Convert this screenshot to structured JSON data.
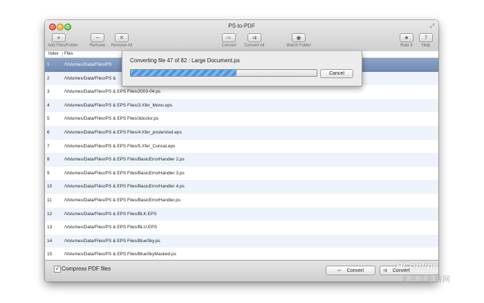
{
  "window": {
    "title": "PS-to-PDF"
  },
  "toolbar": {
    "add_files": "Add Files/Folder",
    "remove": "Remove",
    "remove_all": "Remove All",
    "convert": "Convert",
    "convert_all": "Convert All",
    "watch_folder": "Watch Folder",
    "rate_it": "Rate It",
    "help": "Help"
  },
  "table": {
    "headers": {
      "index": "Index",
      "files": "Files"
    },
    "rows": [
      {
        "index": "1",
        "path": "/Volumes/Data/Files/PS"
      },
      {
        "index": "2",
        "path": "/Volumes/Data/Files/PS &"
      },
      {
        "index": "3",
        "path": "/Volumes/Data/Files/PS & EPS Files/2003-04.ps"
      },
      {
        "index": "4",
        "path": "/Volumes/Data/Files/PS & EPS Files/3.Xfer_Mono.eps"
      },
      {
        "index": "5",
        "path": "/Volumes/Data/Files/PS & EPS Files/3dcolor.ps"
      },
      {
        "index": "6",
        "path": "/Volumes/Data/Files/PS & EPS Files/4.Xfer_posterized.eps"
      },
      {
        "index": "7",
        "path": "/Volumes/Data/Files/PS & EPS Files/5.Xfer_Concat.eps"
      },
      {
        "index": "8",
        "path": "/Volumes/Data/Files/PS & EPS Files/BasicErrorHandler 2.ps"
      },
      {
        "index": "9",
        "path": "/Volumes/Data/Files/PS & EPS Files/BasicErrorHandler 3.ps"
      },
      {
        "index": "10",
        "path": "/Volumes/Data/Files/PS & EPS Files/BasicErrorHandler 4.ps"
      },
      {
        "index": "11",
        "path": "/Volumes/Data/Files/PS & EPS Files/BasicErrorHandler.ps"
      },
      {
        "index": "12",
        "path": "/Volumes/Data/Files/PS & EPS Files/BLK.EPS"
      },
      {
        "index": "13",
        "path": "/Volumes/Data/Files/PS & EPS Files/BLU.EPS"
      },
      {
        "index": "14",
        "path": "/Volumes/Data/Files/PS & EPS Files/BlueSky.ps"
      },
      {
        "index": "15",
        "path": "/Volumes/Data/Files/PS & EPS Files/BlueSkyMasked.ps"
      }
    ]
  },
  "progress_sheet": {
    "label": "Converting file 47 of 82 : Large Document.ps",
    "progress_fraction": 0.57,
    "cancel_label": "Cancel"
  },
  "bottom": {
    "compress_checked": true,
    "compress_label": "Compress PDF files",
    "convert_label": "Convert",
    "convert_all_label": "Convert"
  },
  "watermark": {
    "text": "PConline",
    "cn": "太平洋电脑网"
  },
  "colors": {
    "selection": "#7a90b8",
    "progress": "#5b9ee0"
  }
}
